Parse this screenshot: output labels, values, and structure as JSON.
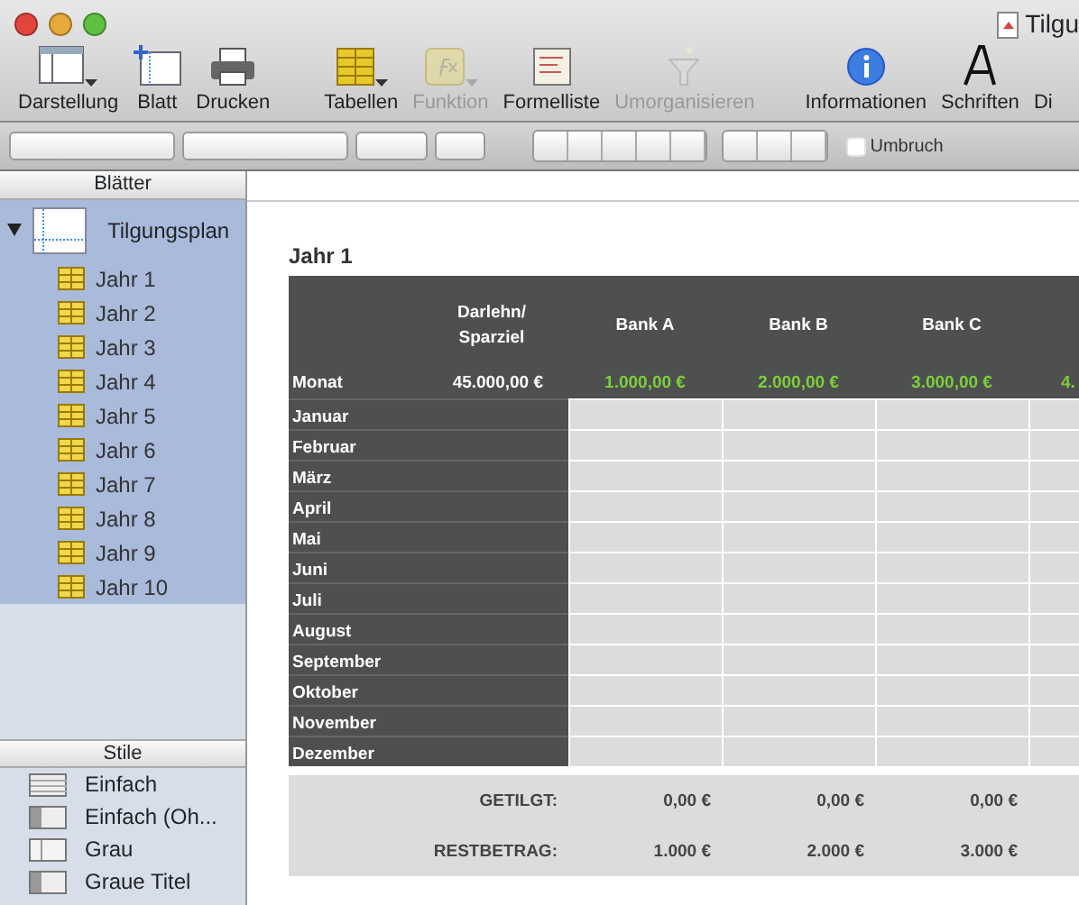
{
  "window": {
    "title": "Tilgu"
  },
  "toolbar": [
    {
      "label": "Darstellung",
      "kind": "view",
      "disabled": false,
      "dropdown": true
    },
    {
      "label": "Blatt",
      "kind": "sheet",
      "disabled": false,
      "dropdown": false
    },
    {
      "label": "Drucken",
      "kind": "print",
      "disabled": false,
      "dropdown": false
    },
    {
      "label": "Tabellen",
      "kind": "table",
      "disabled": false,
      "dropdown": true
    },
    {
      "label": "Funktion",
      "kind": "function",
      "disabled": true,
      "dropdown": true
    },
    {
      "label": "Formelliste",
      "kind": "formulas",
      "disabled": false,
      "dropdown": false
    },
    {
      "label": "Umorganisieren",
      "kind": "funnel",
      "disabled": true,
      "dropdown": false
    },
    {
      "label": "Informationen",
      "kind": "info",
      "disabled": false,
      "dropdown": false
    },
    {
      "label": "Schriften",
      "kind": "fonts",
      "disabled": false,
      "dropdown": false
    },
    {
      "label": "Di",
      "kind": "none",
      "disabled": false,
      "dropdown": false
    }
  ],
  "format_bar": {
    "wrap": {
      "label": "Umbruch",
      "checked": false
    }
  },
  "sidebar": {
    "header": "Blätter",
    "sheets": [
      {
        "label": "Tilgungsplan",
        "expanded": true,
        "selected": true,
        "children": [
          {
            "label": "Jahr 1"
          },
          {
            "label": "Jahr 2"
          },
          {
            "label": "Jahr 3"
          },
          {
            "label": "Jahr 4"
          },
          {
            "label": "Jahr 5"
          },
          {
            "label": "Jahr 6"
          },
          {
            "label": "Jahr 7"
          },
          {
            "label": "Jahr 8"
          },
          {
            "label": "Jahr 9"
          },
          {
            "label": "Jahr 10"
          }
        ]
      }
    ]
  },
  "styles": {
    "header": "Stile",
    "items": [
      {
        "label": "Einfach",
        "kind": "striped"
      },
      {
        "label": "Einfach (Oh...",
        "kind": "side"
      },
      {
        "label": "Grau",
        "kind": "light"
      },
      {
        "label": "Graue Titel",
        "kind": "side"
      }
    ]
  },
  "sheet": {
    "title": "Jahr 1",
    "table": {
      "columns": [
        "Darlehn/\nSparziel",
        "Bank A",
        "Bank B",
        "Bank C"
      ],
      "goal_row": {
        "label": "Monat",
        "goal": "45.000,00 €",
        "deposits": [
          "1.000,00 €",
          "2.000,00 €",
          "3.000,00 €",
          "4."
        ]
      },
      "rows": [
        "Januar",
        "Februar",
        "März",
        "April",
        "Mai",
        "Juni",
        "Juli",
        "August",
        "September",
        "Oktober",
        "November",
        "Dezember"
      ],
      "footer": [
        {
          "label": "GETILGT:",
          "values": [
            "0,00 €",
            "0,00 €",
            "0,00 €"
          ]
        },
        {
          "label": "RESTBETRAG:",
          "values": [
            "1.000 €",
            "2.000 €",
            "3.000 €"
          ]
        }
      ]
    }
  }
}
